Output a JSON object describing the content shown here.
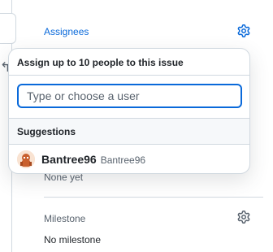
{
  "sidebar": {
    "assignees": {
      "title": "Assignees",
      "empty_text": "None yet"
    },
    "milestone": {
      "title": "Milestone",
      "empty_text": "No milestone"
    }
  },
  "popover": {
    "header": "Assign up to 10 people to this issue",
    "filter": {
      "placeholder": "Type or choose a user",
      "value": ""
    },
    "suggestions_header": "Suggestions",
    "suggestions": [
      {
        "login": "Bantree96",
        "name": "Bantree96",
        "avatar_icon": "user-avatar-icon"
      }
    ]
  },
  "icons": {
    "assignees_settings": "gear-icon",
    "milestone_settings": "gear-icon"
  },
  "colors": {
    "accent": "#0969da",
    "border": "#d1d9e0",
    "muted_text": "#59636e"
  }
}
